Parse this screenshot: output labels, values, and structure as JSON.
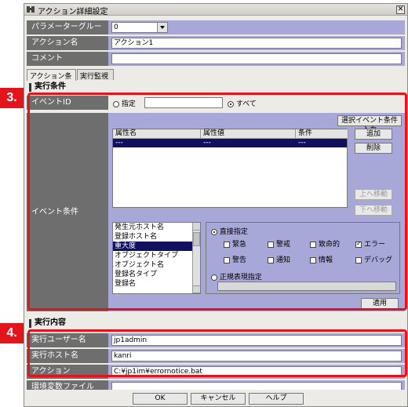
{
  "window": {
    "title": "アクション詳細設定",
    "close_glyph": "✕"
  },
  "top_fields": {
    "param_group_label": "パラメーターグループ",
    "param_group_value": "0",
    "action_name_label": "アクション名",
    "action_name_value": "アクション1",
    "comment_label": "コメント",
    "comment_value": ""
  },
  "tabs": [
    "アクション条件",
    "実行監視"
  ],
  "exec_cond": {
    "heading": "実行条件",
    "event_id_label": "イベントID",
    "radio_specify": "指定",
    "radio_all": "すべて",
    "event_id_value": "",
    "event_cond_label": "イベント条件",
    "select_event_button": "選択イベント条件入力",
    "table_headers": [
      "属性名",
      "属性値",
      "条件"
    ],
    "table_rows": [
      [
        "---",
        "---",
        "---"
      ]
    ],
    "add_button": "追加",
    "delete_button": "削除",
    "move_up_button": "上へ移動",
    "move_down_button": "下へ移動",
    "attribute_list": [
      "発生元ホスト名",
      "登録ホスト名",
      "重大度",
      "オブジェクトタイプ",
      "オブジェクト名",
      "登録名タイプ",
      "登録名"
    ],
    "selected_attribute": "重大度",
    "direct_specify": "直接指定",
    "severity_options": [
      {
        "label": "緊急",
        "checked": false
      },
      {
        "label": "警戒",
        "checked": false
      },
      {
        "label": "致命的",
        "checked": false
      },
      {
        "label": "エラー",
        "checked": true
      },
      {
        "label": "警告",
        "checked": false
      },
      {
        "label": "通知",
        "checked": false
      },
      {
        "label": "情報",
        "checked": false
      },
      {
        "label": "デバッグ",
        "checked": false
      }
    ],
    "regex_specify": "正規表現指定",
    "regex_value": "",
    "apply_button": "適用"
  },
  "exec_content": {
    "heading": "実行内容",
    "user_label": "実行ユーザー名",
    "user_value": "jp1admin",
    "host_label": "実行ホスト名",
    "host_value": "kanri",
    "action_label": "アクション",
    "action_value": "C:¥jp1im¥errornotice.bat",
    "env_file_label": "環境変数ファイル",
    "env_file_value": ""
  },
  "footer": {
    "ok": "OK",
    "cancel": "キャンセル",
    "help": "ヘルプ"
  },
  "markers": {
    "m3": "3.",
    "m4": "4."
  },
  "colors": {
    "highlight_red": "#e3141c",
    "label_gray": "#6e6e6e",
    "value_lavender": "#a8a8d8",
    "selection_navy": "#11115f"
  }
}
